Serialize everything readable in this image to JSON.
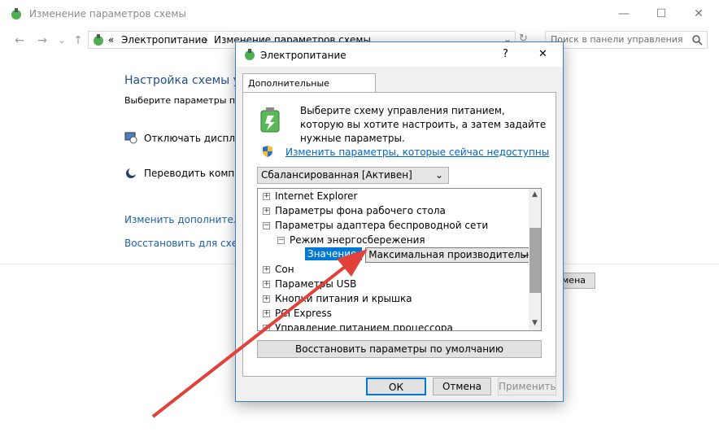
{
  "background_window": {
    "title": "Изменение параметров схемы",
    "controls": {
      "minimize": "—",
      "maximize": "☐",
      "close": "✕"
    },
    "nav": {
      "back": "←",
      "forward": "→",
      "dropdown": "⌄",
      "up": "↑"
    },
    "address": {
      "sep": "«",
      "crumb1": "Электропитание",
      "arrow": "›",
      "crumb2": "Изменение параметров схемы",
      "dd": "⌄",
      "refresh": "↻"
    },
    "search_placeholder": "Поиск в панели управления",
    "heading": "Настройка схемы у",
    "subtitle": "Выберите параметры пе",
    "row_display": "Отключать дисплей:",
    "row_sleep": "Переводить компью",
    "link_advanced": "Изменить дополнительн",
    "link_restore": "Восстановить для схемы",
    "partial_button": "мена"
  },
  "dialog": {
    "title": "Электропитание",
    "help": "?",
    "close": "✕",
    "tab": "Дополнительные параметры",
    "intro": "Выберите схему управления питанием, которую вы хотите настроить, а затем задайте нужные параметры.",
    "change_link": "Изменить параметры, которые сейчас недоступны",
    "scheme": "Сбалансированная [Активен]",
    "tree": [
      {
        "label": "Internet Explorer",
        "expander": "+"
      },
      {
        "label": "Параметры фона рабочего стола",
        "expander": "+"
      },
      {
        "label": "Параметры адаптера беспроводной сети",
        "expander": "−"
      },
      {
        "label": "Режим энергосбережения",
        "expander": "−"
      },
      {
        "value_label": "Значение:",
        "value": "Максимальная производительнос"
      },
      {
        "label": "Сон",
        "expander": "+"
      },
      {
        "label": "Параметры USB",
        "expander": "+"
      },
      {
        "label": "Кнопки питания и крышка",
        "expander": "+"
      },
      {
        "label": "PCI Express",
        "expander": "+"
      },
      {
        "label": "Управление питанием процессора",
        "expander": "+"
      }
    ],
    "restore_button": "Восстановить параметры по умолчанию",
    "ok": "ОК",
    "cancel": "Отмена",
    "apply": "Применить"
  },
  "colors": {
    "accent": "#0078d7",
    "link": "#0066cc",
    "arrow": "#e0413a"
  }
}
